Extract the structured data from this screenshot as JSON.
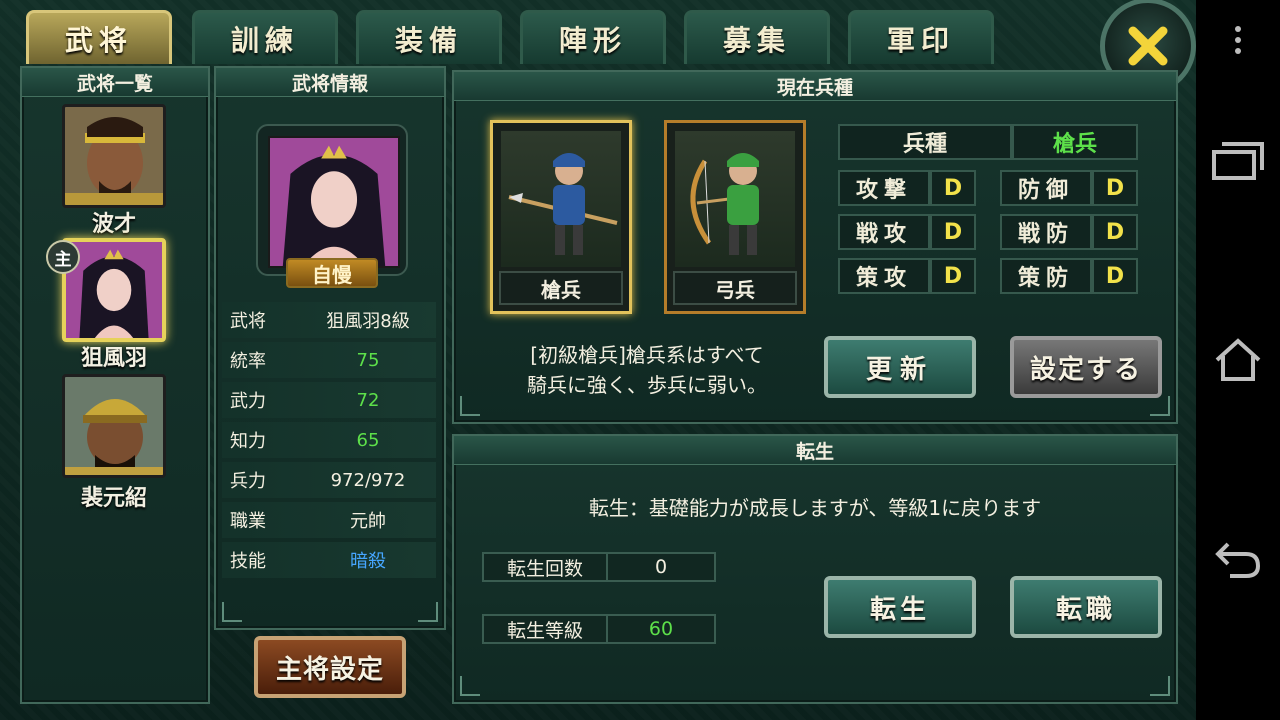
{
  "tabs": [
    {
      "label": "武将",
      "active": true
    },
    {
      "label": "訓練",
      "active": false
    },
    {
      "label": "装備",
      "active": false
    },
    {
      "label": "陣形",
      "active": false
    },
    {
      "label": "募集",
      "active": false
    },
    {
      "label": "軍印",
      "active": false
    }
  ],
  "hero_list": {
    "title": "武将一覧",
    "heroes": [
      {
        "name": "波才",
        "selected": false
      },
      {
        "name": "狙風羽",
        "selected": true,
        "badge": "主"
      },
      {
        "name": "裴元紹",
        "selected": false
      }
    ]
  },
  "hero_info": {
    "title": "武将情報",
    "trait": "自慢",
    "stats": [
      {
        "label": "武将",
        "value": "狙風羽8級",
        "style": "normal"
      },
      {
        "label": "統率",
        "value": "75",
        "style": "green"
      },
      {
        "label": "武力",
        "value": "72",
        "style": "green"
      },
      {
        "label": "知力",
        "value": "65",
        "style": "green"
      },
      {
        "label": "兵力",
        "value": "972/972",
        "style": "normal"
      },
      {
        "label": "職業",
        "value": "元帥",
        "style": "normal"
      },
      {
        "label": "技能",
        "value": "暗殺",
        "style": "blue"
      }
    ],
    "main_button": "主将設定"
  },
  "troops": {
    "title": "現在兵種",
    "cards": [
      {
        "name": "槍兵",
        "selected": true
      },
      {
        "name": "弓兵",
        "selected": false
      }
    ],
    "type_label": "兵種",
    "type_value": "槍兵",
    "grades": [
      {
        "label": "攻撃",
        "value": "D"
      },
      {
        "label": "防御",
        "value": "D"
      },
      {
        "label": "戦攻",
        "value": "D"
      },
      {
        "label": "戦防",
        "value": "D"
      },
      {
        "label": "策攻",
        "value": "D"
      },
      {
        "label": "策防",
        "value": "D"
      }
    ],
    "description_line1": "[初級槍兵]槍兵系はすべて",
    "description_line2": "騎兵に強く、歩兵に弱い。",
    "update_button": "更新",
    "set_button": "設定する"
  },
  "rebirth": {
    "title": "転生",
    "description": "転生：基礎能力が成長しますが、等級1に戻ります",
    "count_label": "転生回数",
    "count_value": "0",
    "level_label": "転生等級",
    "level_value": "60",
    "rebirth_button": "転生",
    "job_change_button": "転職"
  },
  "colors": {
    "accent_gold": "#e6d25a",
    "stat_green": "#5de04a",
    "skill_blue": "#46a6ff",
    "grade_yellow": "#f2e24a"
  }
}
